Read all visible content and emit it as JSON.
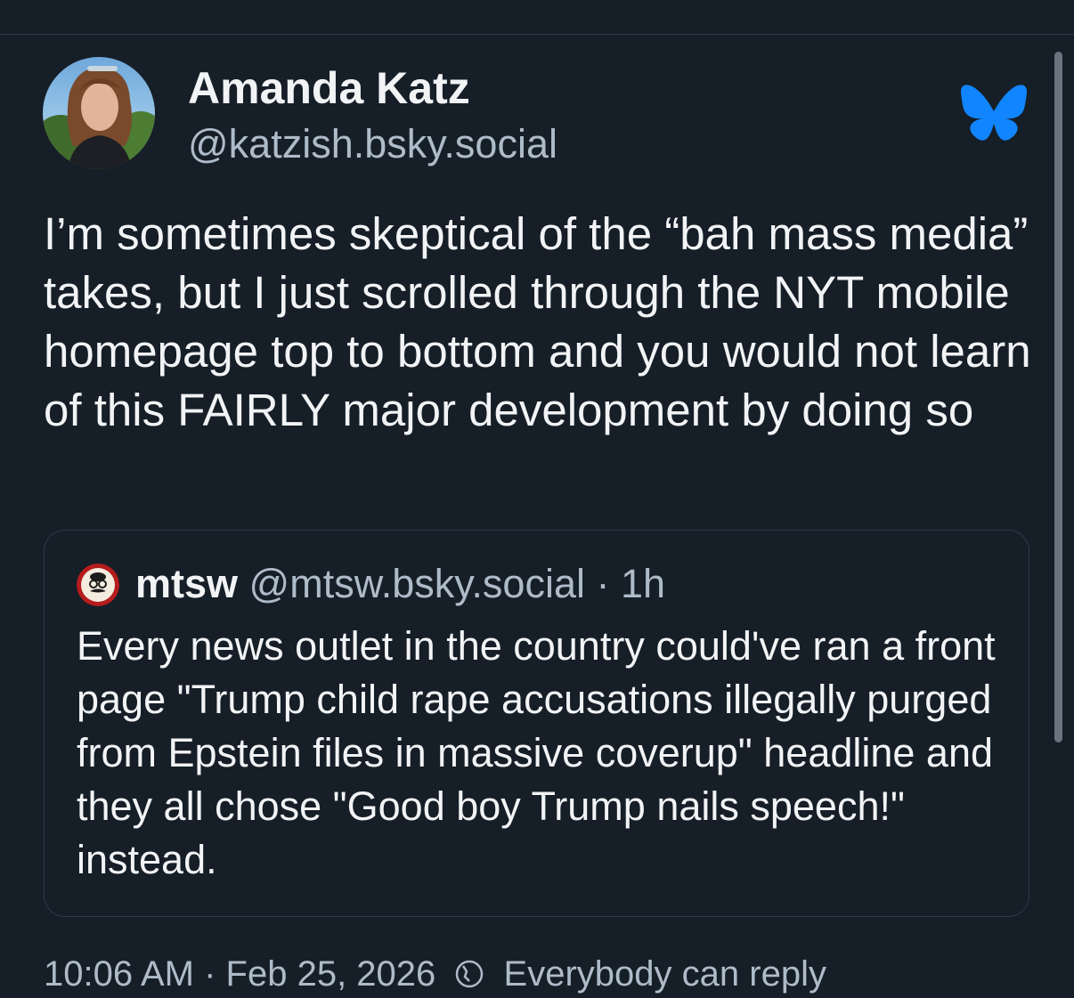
{
  "author": {
    "display_name": "Amanda Katz",
    "handle": "@katzish.bsky.social"
  },
  "post": {
    "text": "I’m sometimes skeptical of the “bah mass media” takes, but I just scrolled through the NYT mobile homepage top to bottom and you would not learn of this FAIRLY major development by doing so"
  },
  "quote": {
    "name": "mtsw",
    "handle": "@mtsw.bsky.social",
    "separator": "·",
    "time": "1h",
    "text": "Every news outlet in the country could've ran a front page \"Trump child rape accusations illegally purged from Epstein files in massive coverup\" headline and they all chose \"Good boy Trump nails speech!\" instead."
  },
  "footer": {
    "timestamp": "10:06 AM · Feb 25, 2026",
    "audience": "Everybody can reply"
  },
  "icons": {
    "brand": "bluesky-butterfly-icon",
    "audience": "globe-icon"
  },
  "colors": {
    "background": "#161e27",
    "brand_blue": "#1185fe",
    "secondary_text": "#aebbc9"
  }
}
